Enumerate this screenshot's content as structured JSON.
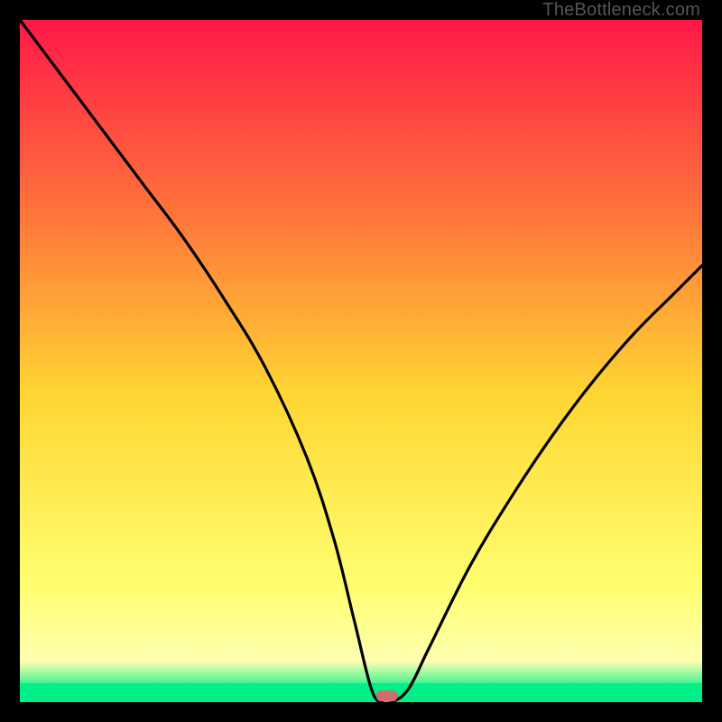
{
  "watermark": "TheBottleneck.com",
  "chart_data": {
    "type": "line",
    "title": "",
    "xlabel": "",
    "ylabel": "",
    "xlim": [
      0,
      100
    ],
    "ylim": [
      0,
      100
    ],
    "grid": false,
    "x": [
      0,
      6,
      12,
      18,
      24,
      30,
      36,
      42,
      46,
      49,
      51.5,
      53,
      54.5,
      57,
      60,
      66,
      72,
      78,
      84,
      90,
      96,
      100
    ],
    "y": [
      100,
      92,
      84,
      76,
      68,
      59,
      49,
      36,
      24,
      12,
      2,
      0,
      0,
      2,
      8,
      20,
      30,
      39,
      47,
      54,
      60,
      64
    ],
    "green_band": {
      "y0": 0,
      "y1": 2.8
    },
    "marker": {
      "x": 53.8,
      "y": 0.9,
      "color": "#d36a6b"
    },
    "gradient": {
      "top": "#ff1848",
      "mid_upper": "#ff7a3a",
      "mid": "#ffd633",
      "mid_lower": "#ffff70",
      "lower": "#ffffb0",
      "bottom": "#00ef89"
    }
  }
}
